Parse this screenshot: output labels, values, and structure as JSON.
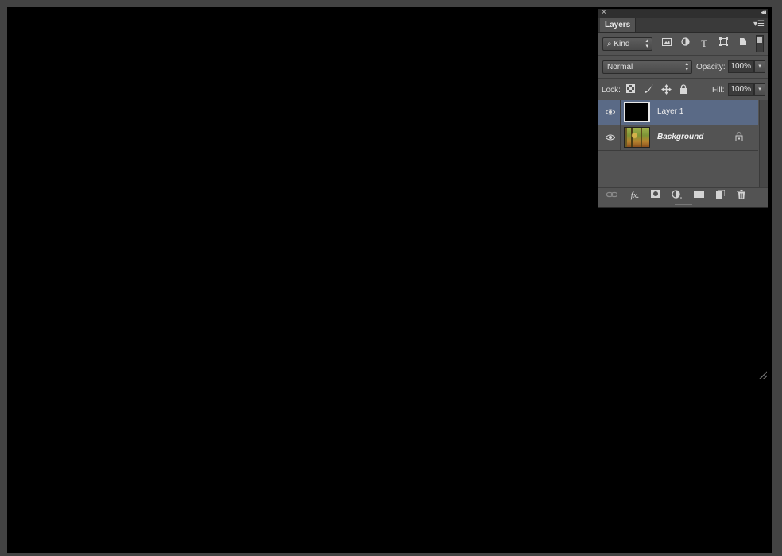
{
  "panel": {
    "title_tab": "Layers",
    "filter": {
      "kind_label": "Kind"
    },
    "blend_mode": "Normal",
    "opacity_label": "Opacity:",
    "opacity_value": "100%",
    "lock_label": "Lock:",
    "fill_label": "Fill:",
    "fill_value": "100%"
  },
  "layers": [
    {
      "name": "Layer 1",
      "visible": true,
      "selected": true,
      "thumbnail": "black"
    },
    {
      "name": "Background",
      "visible": true,
      "selected": false,
      "thumbnail": "forest-photo",
      "locked": true
    }
  ],
  "colors": {
    "canvas": "#000000",
    "app_background": "#434343",
    "panel_background": "#535353",
    "selected_layer": "#5a6a86"
  },
  "icons": {
    "filter_types": [
      "image-filter-icon",
      "adjustment-filter-icon",
      "type-filter-icon",
      "shape-filter-icon",
      "smart-object-filter-icon"
    ],
    "locks": [
      "lock-transparent-icon",
      "lock-paint-icon",
      "lock-position-icon",
      "lock-all-icon"
    ],
    "bottom": [
      "link-icon",
      "fx-icon",
      "mask-icon",
      "adjustment-icon",
      "folder-icon",
      "new-layer-icon",
      "trash-icon"
    ]
  }
}
